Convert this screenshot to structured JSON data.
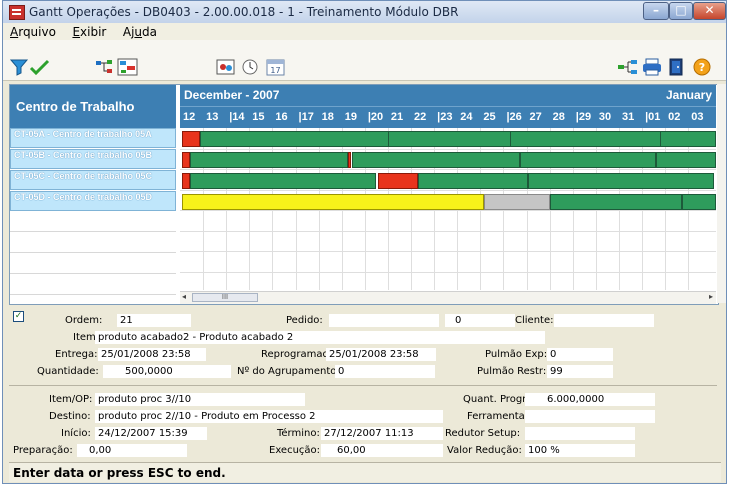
{
  "window": {
    "title": "Gantt Operações - DB0403 - 2.00.00.018 - 1 - Treinamento Módulo DBR"
  },
  "menu": [
    {
      "pre": "",
      "u": "A",
      "post": "rquivo"
    },
    {
      "pre": "",
      "u": "E",
      "post": "xibir"
    },
    {
      "pre": "Aj",
      "u": "u",
      "post": "da"
    }
  ],
  "toolbar": {
    "icons": [
      "filter-icon",
      "check-icon",
      "network-icon",
      "grid-chart-icon",
      "calendar-people-icon",
      "clock-icon",
      "calendar-17-icon",
      "tree-icon",
      "printer-icon",
      "exit-door-icon",
      "help-icon"
    ],
    "calendar_day": "17"
  },
  "gantt": {
    "header_label": "Centro de Trabalho",
    "month_left": "December - 2007",
    "month_right": "January",
    "days": [
      "12",
      "13",
      "|14",
      "15",
      "16",
      "|17",
      "18",
      "19",
      "|20",
      "21",
      "22",
      "|23",
      "24",
      "25",
      "|26",
      "27",
      "28",
      "|29",
      "30",
      "31",
      "|01",
      "02",
      "03"
    ],
    "rows": [
      {
        "label": "CT-05A - Centro de trabalho 05A"
      },
      {
        "label": "CT-05B - Centro de trabalho 05B"
      },
      {
        "label": "CT-05C - Centro de trabalho 05C"
      },
      {
        "label": "CT-05D - Centro de trabalho 05D"
      }
    ],
    "colors": {
      "green": "#2e9c5c",
      "red": "#e8341c",
      "yellow": "#f7f21a",
      "gray": "#c5c5c5"
    },
    "scroll_thumb": "III"
  },
  "form": {
    "ordem_label": "Ordem:",
    "ordem": "21",
    "pedido_label": "Pedido:",
    "pedido": "0",
    "cliente_label": "Cliente:",
    "cliente": "",
    "item_label": "Item:",
    "item": "produto acabado2 - Produto acabado 2",
    "entrega_label": "Entrega:",
    "entrega": "25/01/2008 23:58",
    "reprogramada_label": "Reprogramada:",
    "reprogramada": "25/01/2008 23:58",
    "pulmao_exp_label": "Pulmão Exp:",
    "pulmao_exp": "0",
    "quantidade_label": "Quantidade:",
    "quantidade": "500,0000",
    "agrupamento_label": "Nº do Agrupamento:",
    "agrupamento": "0",
    "pulmao_restr_label": "Pulmão Restr:",
    "pulmao_restr": "99",
    "item_op_label": "Item/OP:",
    "item_op": "produto proc 3//10",
    "quant_progr_label": "Quant. Progr:",
    "quant_progr": "6.000,0000",
    "destino_label": "Destino:",
    "destino": "produto proc 2//10 - Produto em Processo 2",
    "ferramenta_label": "Ferramenta:",
    "ferramenta": "",
    "inicio_label": "Início:",
    "inicio": "24/12/2007 15:39",
    "termino_label": "Término:",
    "termino": "27/12/2007 11:13",
    "redutor_label": "Redutor Setup:",
    "redutor": "",
    "preparacao_label": "Preparação:",
    "preparacao": "0,00",
    "execucao_label": "Execução:",
    "execucao": "60,00",
    "valor_reducao_label": "Valor Redução:",
    "valor_reducao": "100 %"
  },
  "status": {
    "text": "Enter data or press ESC to end."
  }
}
